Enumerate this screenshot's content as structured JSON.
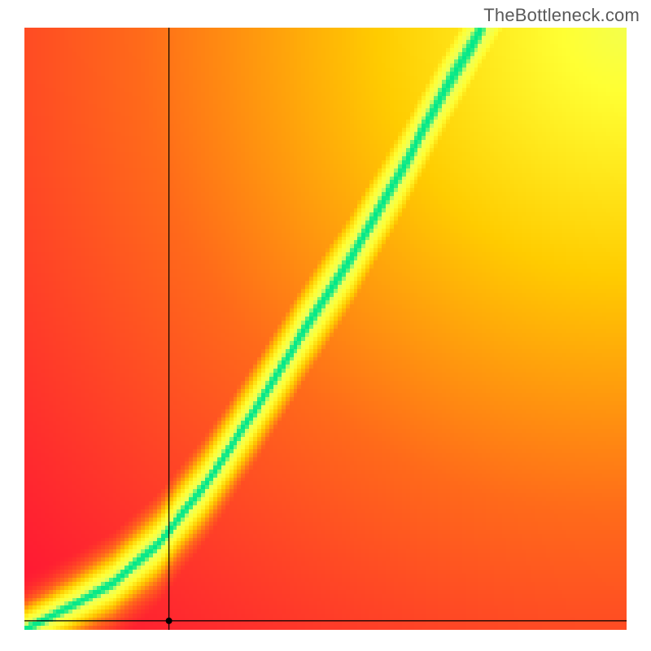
{
  "attribution": "TheBottleneck.com",
  "chart_data": {
    "type": "heatmap",
    "title": "",
    "xlabel": "",
    "ylabel": "",
    "xlim": [
      0,
      1
    ],
    "ylim": [
      0,
      1
    ],
    "grid": false,
    "legend": false,
    "colorscale": [
      {
        "t": 0.0,
        "color": "#ff1a33"
      },
      {
        "t": 0.3,
        "color": "#ff6a1a"
      },
      {
        "t": 0.55,
        "color": "#ffcc00"
      },
      {
        "t": 0.75,
        "color": "#ffff33"
      },
      {
        "t": 0.88,
        "color": "#eaff60"
      },
      {
        "t": 1.0,
        "color": "#00e88a"
      }
    ],
    "ridge": {
      "points": [
        {
          "x": 0.0,
          "y": 0.0
        },
        {
          "x": 0.08,
          "y": 0.04
        },
        {
          "x": 0.15,
          "y": 0.08
        },
        {
          "x": 0.22,
          "y": 0.14
        },
        {
          "x": 0.3,
          "y": 0.24
        },
        {
          "x": 0.38,
          "y": 0.36
        },
        {
          "x": 0.46,
          "y": 0.49
        },
        {
          "x": 0.55,
          "y": 0.63
        },
        {
          "x": 0.63,
          "y": 0.77
        },
        {
          "x": 0.7,
          "y": 0.9
        },
        {
          "x": 0.76,
          "y": 1.0
        }
      ],
      "half_width_normalized": 0.045,
      "green_falloff": 2.2
    },
    "background_glow": {
      "center_x": 1.0,
      "center_y": 1.0,
      "radius": 1.35
    },
    "crosshair": {
      "x": 0.24,
      "y": 0.015,
      "dot_radius_px": 4
    },
    "resolution": 150
  }
}
